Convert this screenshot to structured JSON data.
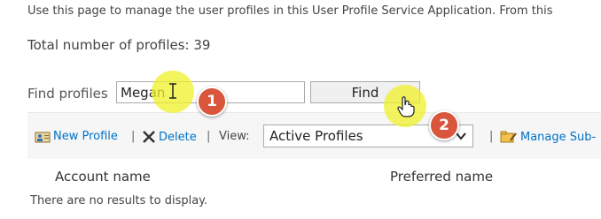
{
  "intro_text": "Use this page to manage the user profiles in this User Profile Service Application. From this",
  "total_profiles_text": "Total number of profiles: 39",
  "find": {
    "label": "Find profiles",
    "input_value": "Megan",
    "button_label": "Find"
  },
  "toolbar": {
    "new_profile": "New Profile",
    "delete": "Delete",
    "view_label": "View:",
    "view_selected": "Active Profiles",
    "manage_sub": "Manage Sub-",
    "separator": "|"
  },
  "columns": [
    "Account name",
    "Preferred name"
  ],
  "empty_message": "There are no results to display.",
  "annotations": {
    "step1": "1",
    "step2": "2",
    "highlight_color": "#f0f028",
    "badge_color": "#d9553b"
  },
  "icons": {
    "new_profile": "user-card-icon",
    "delete": "x-icon",
    "manage_sub": "folder-pencil-icon",
    "cursor_text": "text-cursor-icon",
    "cursor_hand": "hand-pointer-icon"
  }
}
